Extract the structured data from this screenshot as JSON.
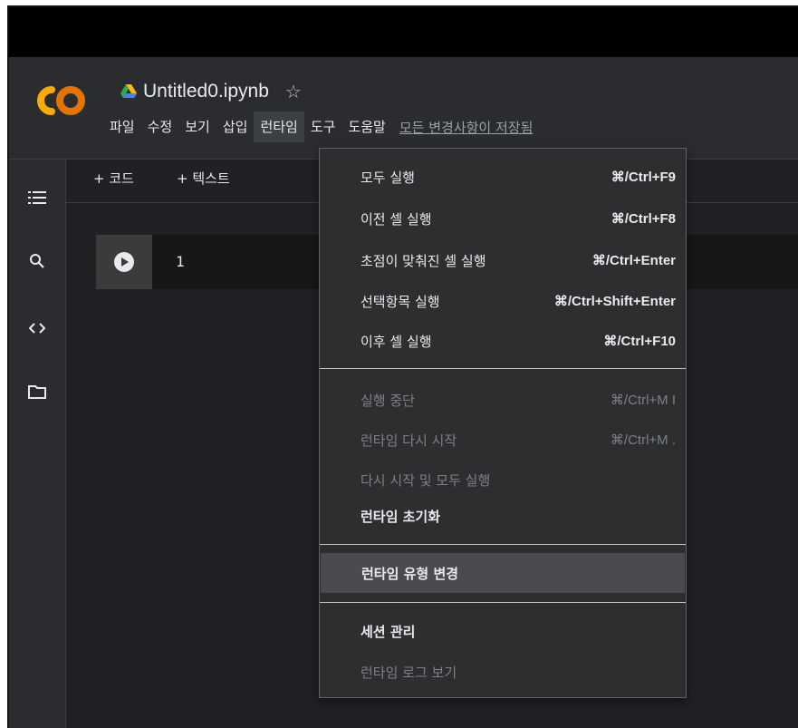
{
  "document": {
    "title": "Untitled0.ipynb",
    "star_glyph": "☆",
    "save_status": "모든 변경사항이 저장됨"
  },
  "menubar": {
    "items": [
      "파일",
      "수정",
      "보기",
      "삽입",
      "런타임",
      "도구",
      "도움말"
    ],
    "active": "런타임"
  },
  "toolbar": {
    "add_code": "+ 코드",
    "add_text": "+ 텍스트"
  },
  "sidebar": {
    "icons": [
      "table-of-contents-icon",
      "search-icon",
      "code-snippets-icon",
      "files-icon"
    ]
  },
  "cell": {
    "line_number": "1"
  },
  "runtime_menu": {
    "items": [
      {
        "label": "모두 실행",
        "shortcut": "⌘/Ctrl+F9",
        "enabled": true
      },
      {
        "label": "이전 셀 실행",
        "shortcut": "⌘/Ctrl+F8",
        "enabled": true
      },
      {
        "label": "초점이 맞춰진 셀 실행",
        "shortcut": "⌘/Ctrl+Enter",
        "enabled": true
      },
      {
        "label": "선택항목 실행",
        "shortcut": "⌘/Ctrl+Shift+Enter",
        "enabled": true
      },
      {
        "label": "이후 셀 실행",
        "shortcut": "⌘/Ctrl+F10",
        "enabled": true
      },
      {
        "label": "실행 중단",
        "shortcut": "⌘/Ctrl+M I",
        "enabled": false
      },
      {
        "label": "런타임 다시 시작",
        "shortcut": "⌘/Ctrl+M .",
        "enabled": false
      },
      {
        "label": "다시 시작 및 모두 실행",
        "shortcut": "",
        "enabled": false
      },
      {
        "label": "런타임 초기화",
        "shortcut": "",
        "enabled": true
      },
      {
        "label": "런타임 유형 변경",
        "shortcut": "",
        "enabled": true,
        "highlighted": true
      },
      {
        "label": "세션 관리",
        "shortcut": "",
        "enabled": true
      },
      {
        "label": "런타임 로그 보기",
        "shortcut": "",
        "enabled": false
      }
    ]
  },
  "colors": {
    "background": "#202124",
    "logo_orange": "#f9ab00",
    "logo_dark_orange": "#e37400",
    "menu_background": "#2d2e30"
  }
}
